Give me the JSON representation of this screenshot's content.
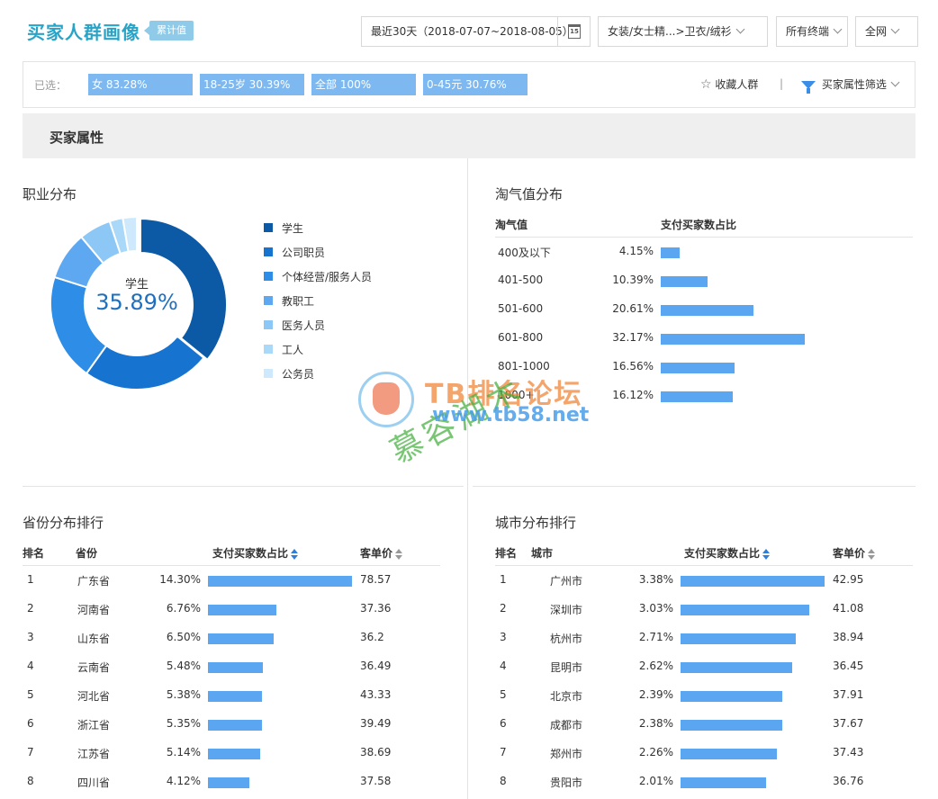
{
  "header": {
    "title": "买家人群画像",
    "badge": "累计值",
    "date_range": "最近30天（2018-07-07~2018-08-05）",
    "calendar_day": "15",
    "category": "女装/女士精...>卫衣/绒衫",
    "terminal": "所有终端",
    "network": "全网"
  },
  "selected": {
    "label": "已选：",
    "chips": [
      "女 83.28%",
      "18-25岁 30.39%",
      "全部 100%",
      "0-45元 30.76%"
    ],
    "favorite": "收藏人群",
    "separator": "|",
    "filter": "买家属性筛选"
  },
  "section_title": "买家属性",
  "occupation": {
    "title": "职业分布",
    "center_label": "学生",
    "center_value": "35.89%",
    "items": [
      {
        "label": "学生",
        "color": "#0c5aa6"
      },
      {
        "label": "公司职员",
        "color": "#1673d0"
      },
      {
        "label": "个体经营/服务人员",
        "color": "#2e8de6"
      },
      {
        "label": "教职工",
        "color": "#5da8f0"
      },
      {
        "label": "医务人员",
        "color": "#8cc7f6"
      },
      {
        "label": "工人",
        "color": "#a9d8f8"
      },
      {
        "label": "公务员",
        "color": "#cde9fb"
      }
    ]
  },
  "taoqi": {
    "title": "淘气值分布",
    "col1": "淘气值",
    "col2": "支付买家数占比",
    "rows": [
      {
        "range": "400及以下",
        "pct": "4.15%",
        "value": 4.15
      },
      {
        "range": "401-500",
        "pct": "10.39%",
        "value": 10.39
      },
      {
        "range": "501-600",
        "pct": "20.61%",
        "value": 20.61
      },
      {
        "range": "601-800",
        "pct": "32.17%",
        "value": 32.17
      },
      {
        "range": "801-1000",
        "pct": "16.56%",
        "value": 16.56
      },
      {
        "range": "1000+",
        "pct": "16.12%",
        "value": 16.12
      }
    ]
  },
  "province": {
    "title": "省份分布排行",
    "cols": [
      "排名",
      "省份",
      "支付买家数占比",
      "客单价"
    ],
    "rows": [
      {
        "rank": "1",
        "name": "广东省",
        "pct": "14.30%",
        "value": 14.3,
        "price": "78.57"
      },
      {
        "rank": "2",
        "name": "河南省",
        "pct": "6.76%",
        "value": 6.76,
        "price": "37.36"
      },
      {
        "rank": "3",
        "name": "山东省",
        "pct": "6.50%",
        "value": 6.5,
        "price": "36.2"
      },
      {
        "rank": "4",
        "name": "云南省",
        "pct": "5.48%",
        "value": 5.48,
        "price": "36.49"
      },
      {
        "rank": "5",
        "name": "河北省",
        "pct": "5.38%",
        "value": 5.38,
        "price": "43.33"
      },
      {
        "rank": "6",
        "name": "浙江省",
        "pct": "5.35%",
        "value": 5.35,
        "price": "39.49"
      },
      {
        "rank": "7",
        "name": "江苏省",
        "pct": "5.14%",
        "value": 5.14,
        "price": "38.69"
      },
      {
        "rank": "8",
        "name": "四川省",
        "pct": "4.12%",
        "value": 4.12,
        "price": "37.58"
      }
    ]
  },
  "city": {
    "title": "城市分布排行",
    "cols": [
      "排名",
      "城市",
      "支付买家数占比",
      "客单价"
    ],
    "rows": [
      {
        "rank": "1",
        "name": "广州市",
        "pct": "3.38%",
        "value": 3.38,
        "price": "42.95"
      },
      {
        "rank": "2",
        "name": "深圳市",
        "pct": "3.03%",
        "value": 3.03,
        "price": "41.08"
      },
      {
        "rank": "3",
        "name": "杭州市",
        "pct": "2.71%",
        "value": 2.71,
        "price": "38.94"
      },
      {
        "rank": "4",
        "name": "昆明市",
        "pct": "2.62%",
        "value": 2.62,
        "price": "36.45"
      },
      {
        "rank": "5",
        "name": "北京市",
        "pct": "2.39%",
        "value": 2.39,
        "price": "37.91"
      },
      {
        "rank": "6",
        "name": "成都市",
        "pct": "2.38%",
        "value": 2.38,
        "price": "37.67"
      },
      {
        "rank": "7",
        "name": "郑州市",
        "pct": "2.26%",
        "value": 2.26,
        "price": "37.43"
      },
      {
        "rank": "8",
        "name": "贵阳市",
        "pct": "2.01%",
        "value": 2.01,
        "price": "36.76"
      }
    ]
  },
  "watermark": {
    "line1": "TB排名论坛",
    "line2": "www.tb58.net",
    "line3": "慕容湖木"
  },
  "chart_data": [
    {
      "type": "pie",
      "title": "职业分布",
      "categories": [
        "学生",
        "公司职员",
        "个体经营/服务人员",
        "教职工",
        "医务人员",
        "工人",
        "公务员"
      ],
      "values": [
        35.89,
        24.0,
        20.0,
        9.0,
        6.0,
        2.5,
        2.6
      ]
    },
    {
      "type": "bar",
      "title": "淘气值分布",
      "categories": [
        "400及以下",
        "401-500",
        "501-600",
        "601-800",
        "801-1000",
        "1000+"
      ],
      "values": [
        4.15,
        10.39,
        20.61,
        32.17,
        16.56,
        16.12
      ]
    },
    {
      "type": "bar",
      "title": "省份分布排行",
      "categories": [
        "广东省",
        "河南省",
        "山东省",
        "云南省",
        "河北省",
        "浙江省",
        "江苏省",
        "四川省"
      ],
      "values": [
        14.3,
        6.76,
        6.5,
        5.48,
        5.38,
        5.35,
        5.14,
        4.12
      ]
    },
    {
      "type": "bar",
      "title": "城市分布排行",
      "categories": [
        "广州市",
        "深圳市",
        "杭州市",
        "昆明市",
        "北京市",
        "成都市",
        "郑州市",
        "贵阳市"
      ],
      "values": [
        3.38,
        3.03,
        2.71,
        2.62,
        2.39,
        2.38,
        2.26,
        2.01
      ]
    }
  ]
}
